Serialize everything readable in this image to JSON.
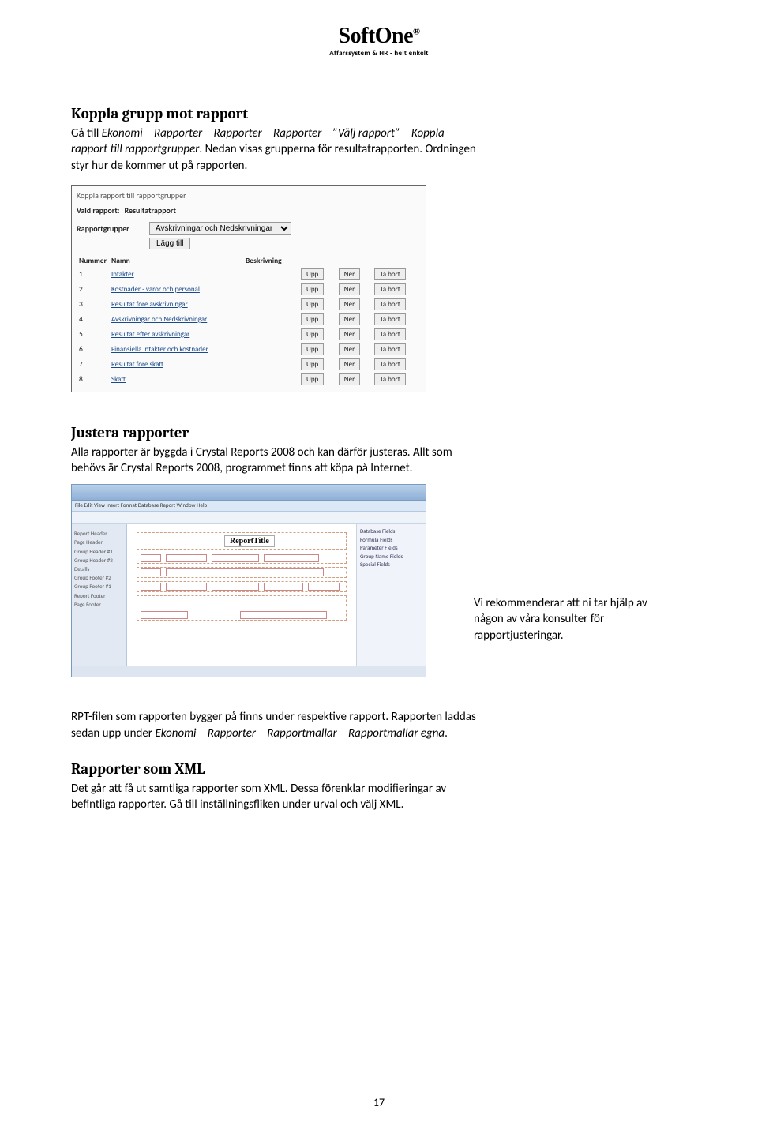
{
  "logo": {
    "text": "SoftOne",
    "reg": "®",
    "tagline": "Affärssystem & HR - helt enkelt"
  },
  "section1": {
    "heading": "Koppla grupp mot rapport",
    "p1_a": "Gå till ",
    "p1_i": "Ekonomi – Rapporter – Rapporter – Rapporter – ”Välj rapport” – Koppla rapport till rapportgrupper",
    "p1_b": ". Nedan visas grupperna för resultatrapporten. Ordningen styr hur de kommer ut på rapporten."
  },
  "shot1": {
    "title": "Koppla rapport till rapportgrupper",
    "vald_label": "Vald rapport:",
    "vald_value": "Resultatrapport",
    "grupper_label": "Rapportgrupper",
    "dd_value": "Avskrivningar och Nedskrivningar",
    "add_btn": "Lägg till",
    "cols": {
      "num": "Nummer",
      "namn": "Namn",
      "besk": "Beskrivning"
    },
    "rows": [
      {
        "n": "1",
        "name": "Intäkter"
      },
      {
        "n": "2",
        "name": "Kostnader - varor och personal"
      },
      {
        "n": "3",
        "name": "Resultat före avskrivningar"
      },
      {
        "n": "4",
        "name": "Avskrivningar och Nedskrivningar"
      },
      {
        "n": "5",
        "name": "Resultat efter avskrivningar"
      },
      {
        "n": "6",
        "name": "Finansiella intäkter och kostnader"
      },
      {
        "n": "7",
        "name": "Resultat före skatt"
      },
      {
        "n": "8",
        "name": "Skatt"
      }
    ],
    "btn_upp": "Upp",
    "btn_ner": "Ner",
    "btn_tabort": "Ta bort"
  },
  "section2": {
    "heading": "Justera rapporter",
    "p1": "Alla rapporter är byggda i Crystal Reports 2008 och kan därför justeras. Allt som behövs är Crystal Reports 2008, programmet finns att köpa på Internet."
  },
  "shot2": {
    "menu": "File   Edit   View   Insert   Format   Database   Report   Window   Help",
    "report_title": "ReportTitle",
    "left_items": [
      "Report Header",
      "Page Header",
      "Group Header #1",
      "Group Header #2",
      "Details",
      "Group Footer #2",
      "Group Footer #1",
      "Report Footer",
      "Page Footer"
    ],
    "right_items": [
      "Database Fields",
      "Formula Fields",
      "Parameter Fields",
      "Group Name Fields",
      "Special Fields"
    ]
  },
  "sidenote": "Vi rekommenderar att ni tar hjälp av någon av våra konsulter för rapportjusteringar.",
  "section3": {
    "p1": "RPT-filen som rapporten bygger på finns under respektive rapport. Rapporten laddas sedan upp under ",
    "p1_i": "Ekonomi – Rapporter – Rapportmallar – Rapportmallar egna",
    "p1_end": "."
  },
  "section4": {
    "heading": "Rapporter som XML",
    "p1": "Det går att få ut samtliga rapporter som XML. Dessa förenklar modifieringar av befintliga rapporter.  Gå till inställningsfliken under urval och välj XML."
  },
  "pagenum": "17"
}
